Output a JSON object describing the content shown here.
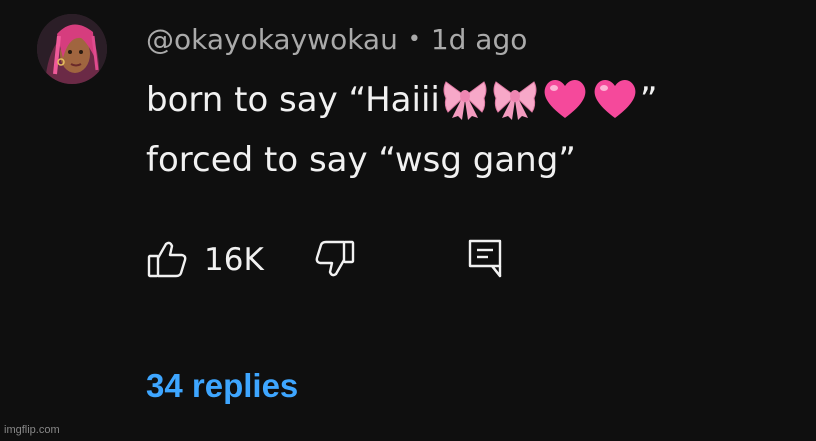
{
  "comment": {
    "author": "@okayokaywokau",
    "separator": "•",
    "timestamp": "1d ago",
    "line1_prefix": "born to say “Haiii",
    "line1_suffix": "”",
    "line1_emojis": [
      "ribbon",
      "ribbon",
      "pink-heart",
      "pink-heart"
    ],
    "line2": "forced to say “wsg gang”",
    "like_count": "16K",
    "replies_label": "34 replies"
  },
  "colors": {
    "background": "#0f0f0f",
    "text": "#f1f1f1",
    "secondary": "#aaaaaa",
    "link": "#3ea6ff"
  },
  "icons": {
    "like": "thumbs-up-icon",
    "dislike": "thumbs-down-icon",
    "reply": "comment-icon"
  },
  "watermark": "imgflip.com"
}
